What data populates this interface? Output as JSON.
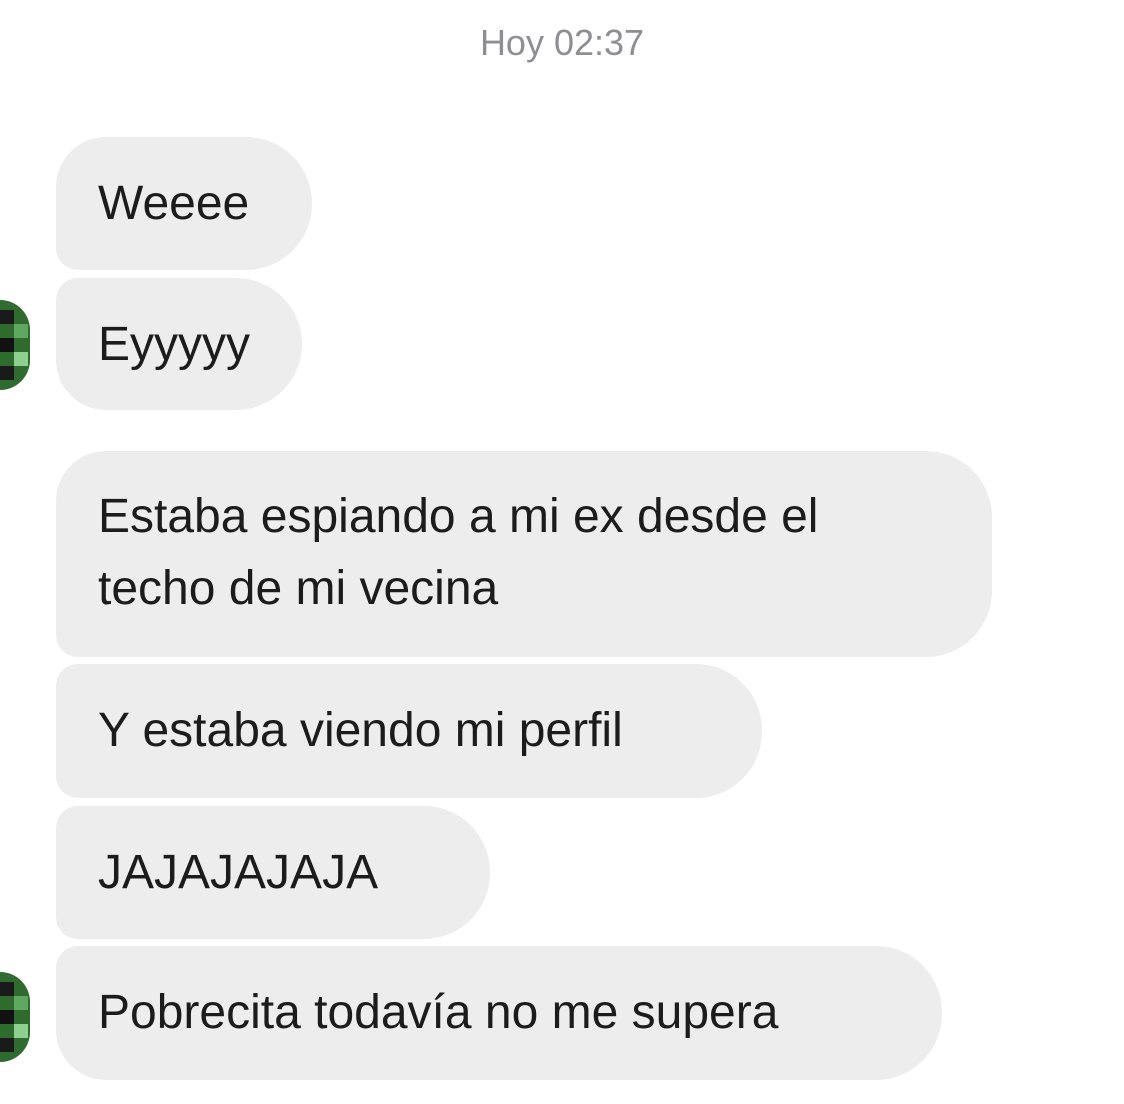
{
  "chat": {
    "timestamp": "Hoy 02:37",
    "messages": [
      {
        "text": "Weeee"
      },
      {
        "text": "Eyyyyy"
      },
      {
        "lines": [
          "Estaba espiando a mi ex desde el",
          "techo de mi vecina"
        ]
      },
      {
        "text": "Y estaba viendo mi perfil"
      },
      {
        "text": "JAJAJAJAJA"
      },
      {
        "text": "Pobrecita todavía no me supera"
      }
    ]
  },
  "colors": {
    "bubble_bg": "#ededed",
    "text": "#1c1c1c",
    "timestamp": "#8e8e93",
    "avatar_green": "#2f6b2f"
  }
}
